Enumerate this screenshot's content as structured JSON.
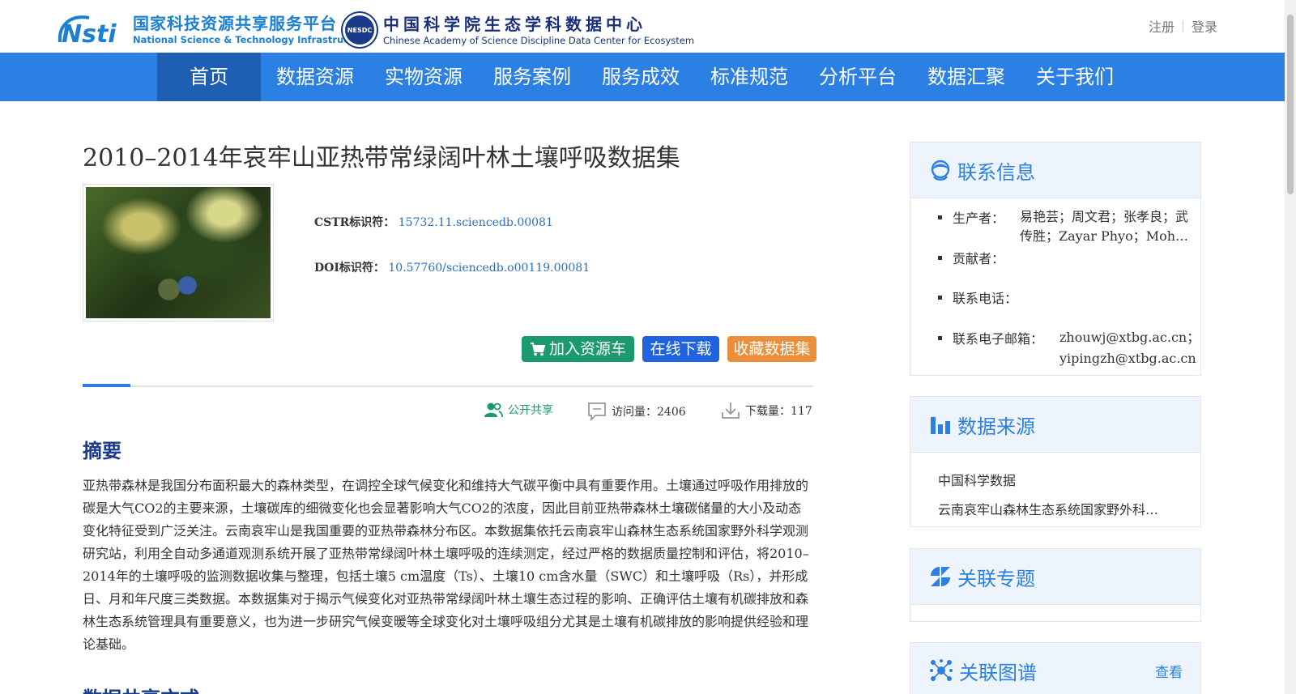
{
  "header": {
    "nsti_logo_mark": "Nsti",
    "nsti_cn": "国家科技资源共享服务平台",
    "nsti_en": "National Science & Technology Infrastructure",
    "nesdc_badge": "NESDC",
    "nesdc_cn": "中国科学院生态学科数据中心",
    "nesdc_en": "Chinese Academy of Science Discipline Data Center for Ecosystem",
    "register": "注册",
    "login": "登录"
  },
  "nav": {
    "items": [
      "首页",
      "数据资源",
      "实物资源",
      "服务案例",
      "服务成效",
      "标准规范",
      "分析平台",
      "数据汇聚",
      "关于我们"
    ]
  },
  "dataset": {
    "title": "2010–2014年哀牢山亚热带常绿阔叶林土壤呼吸数据集",
    "cstr_label": "CSTR标识符：",
    "cstr_value": "15732.11.sciencedb.00081",
    "doi_label": "DOI标识符：",
    "doi_value": "10.57760/sciencedb.o00119.00081",
    "btn_cart": "加入资源车",
    "btn_download": "在线下载",
    "btn_favorite": "收藏数据集",
    "share_label": "公开共享",
    "visits": "访问量：2406",
    "downloads": "下载量：117",
    "abstract_heading": "摘要",
    "abstract": "亚热带森林是我国分布面积最大的森林类型，在调控全球气候变化和维持大气碳平衡中具有重要作用。土壤通过呼吸作用排放的碳是大气CO2的主要来源，土壤碳库的细微变化也会显著影响大气CO2的浓度，因此目前亚热带森林土壤碳储量的大小及动态变化特征受到广泛关注。云南哀牢山是我国重要的亚热带森林分布区。本数据集依托云南哀牢山森林生态系统国家野外科学观测研究站，利用全自动多通道观测系统开展了亚热带常绿阔叶林土壤呼吸的连续测定，经过严格的数据质量控制和评估，将2010–2014年的土壤呼吸的监测数据收集与整理，包括土壤5 cm温度（Ts）、土壤10 cm含水量（SWC）和土壤呼吸（Rs），并形成日、月和年尺度三类数据。本数据集对于揭示气候变化对亚热带常绿阔叶林土壤生态过程的影响、正确评估土壤有机碳排放和森林生态系统管理具有重要意义，也为进一步研究气候变暖等全球变化对土壤呼吸组分尤其是土壤有机碳排放的影响提供经验和理论基础。",
    "next_heading": "数据共享方式"
  },
  "sidebar": {
    "contact": {
      "title": "联系信息",
      "producer_label": "生产者：",
      "producer_value": "易艳芸；周文君；张孝良；武传胜；Zayar Phyo；Moh…",
      "contributor_label": "贡献者：",
      "phone_label": "联系电话：",
      "email_label": "联系电子邮箱：",
      "email_value": "zhouwj@xtbg.ac.cn；yipingzh@xtbg.ac.cn"
    },
    "source": {
      "title": "数据来源",
      "item1": "中国科学数据",
      "item2": "云南哀牢山森林生态系统国家野外科…"
    },
    "topic": {
      "title": "关联专题"
    },
    "graph": {
      "title": "关联图谱",
      "more": "查看"
    }
  }
}
